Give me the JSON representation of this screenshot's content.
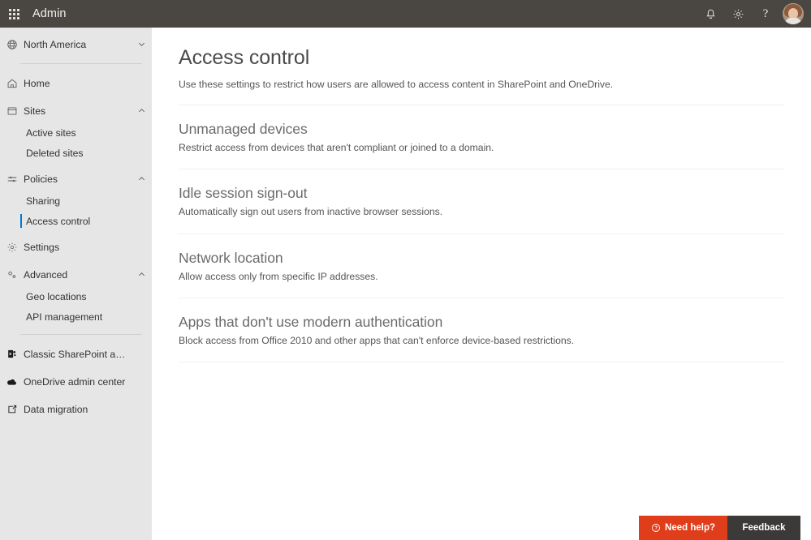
{
  "topbar": {
    "waffle_label": "app-launcher",
    "brand": "Admin",
    "icons": [
      {
        "name": "bell-icon",
        "label": "Notifications"
      },
      {
        "name": "gear-icon",
        "label": "Settings"
      },
      {
        "name": "help-icon",
        "label": "?"
      }
    ],
    "avatar_label": "User account"
  },
  "sidebar": {
    "region": {
      "label": "North America",
      "icon": "globe-icon",
      "chevron": "chevron-down-icon"
    },
    "items": [
      {
        "label": "Home",
        "icon": "home-icon",
        "chevron": ""
      },
      {
        "label": "Sites",
        "icon": "sites-icon",
        "chevron": "chevron-up-icon"
      },
      {
        "label": "Active sites",
        "sub": true,
        "selected": false
      },
      {
        "label": "Deleted sites",
        "sub": true,
        "selected": false
      },
      {
        "label": "Policies",
        "icon": "sliders-icon",
        "chevron": "chevron-up-icon"
      },
      {
        "label": "Sharing",
        "sub": true,
        "selected": false
      },
      {
        "label": "Access control",
        "sub": true,
        "selected": true
      },
      {
        "label": "Settings",
        "icon": "gear-icon",
        "chevron": ""
      },
      {
        "label": "Advanced",
        "icon": "advanced-icon",
        "chevron": "chevron-up-icon"
      },
      {
        "label": "Geo locations",
        "sub": true,
        "selected": false
      },
      {
        "label": "API management",
        "sub": true,
        "selected": false
      },
      {
        "label": "Classic SharePoint admin ce...",
        "icon": "sharepoint-icon",
        "chevron": ""
      },
      {
        "label": "OneDrive admin center",
        "icon": "onedrive-icon",
        "chevron": ""
      },
      {
        "label": "Data migration",
        "icon": "migration-icon",
        "chevron": ""
      }
    ]
  },
  "main": {
    "title": "Access control",
    "subtitle": "Use these settings to restrict how users are allowed to access content in SharePoint and OneDrive.",
    "sections": [
      {
        "title": "Unmanaged devices",
        "desc": "Restrict access from devices that aren't compliant or joined to a domain."
      },
      {
        "title": "Idle session sign-out",
        "desc": "Automatically sign out users from inactive browser sessions."
      },
      {
        "title": "Network location",
        "desc": "Allow access only from specific IP addresses."
      },
      {
        "title": "Apps that don't use modern authentication",
        "desc": "Block access from Office 2010 and other apps that can't enforce device-based restrictions."
      }
    ]
  },
  "footer": {
    "help_label": "Need help?",
    "feedback_label": "Feedback"
  },
  "colors": {
    "topbar_bg": "#4a4642",
    "sidebar_bg": "#e6e6e6",
    "accent_selected": "#0078d4",
    "help_bg": "#e03e1a",
    "feedback_bg": "#3b3a39"
  }
}
